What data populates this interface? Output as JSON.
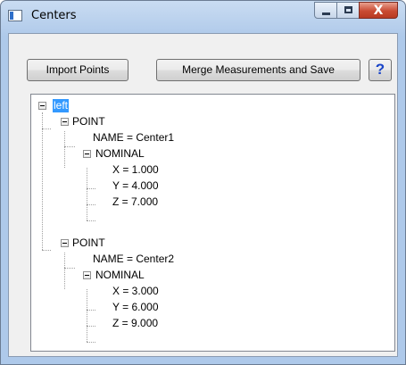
{
  "window": {
    "title": "Centers",
    "close_glyph": "X"
  },
  "toolbar": {
    "import_label": "Import Points",
    "merge_label": "Merge Measurements and Save",
    "help_label": "?"
  },
  "tree": {
    "root": "left",
    "points": [
      {
        "label": "POINT",
        "name": "NAME = Center1",
        "nominal": "NOMINAL",
        "x": "X = 1.000",
        "y": "Y = 4.000",
        "z": "Z = 7.000"
      },
      {
        "label": "POINT",
        "name": "NAME = Center2",
        "nominal": "NOMINAL",
        "x": "X = 3.000",
        "y": "Y = 6.000",
        "z": "Z = 9.000"
      }
    ]
  },
  "colors": {
    "selection": "#3399ff",
    "help_icon": "#1a45c8",
    "close_button": "#c94a33"
  }
}
